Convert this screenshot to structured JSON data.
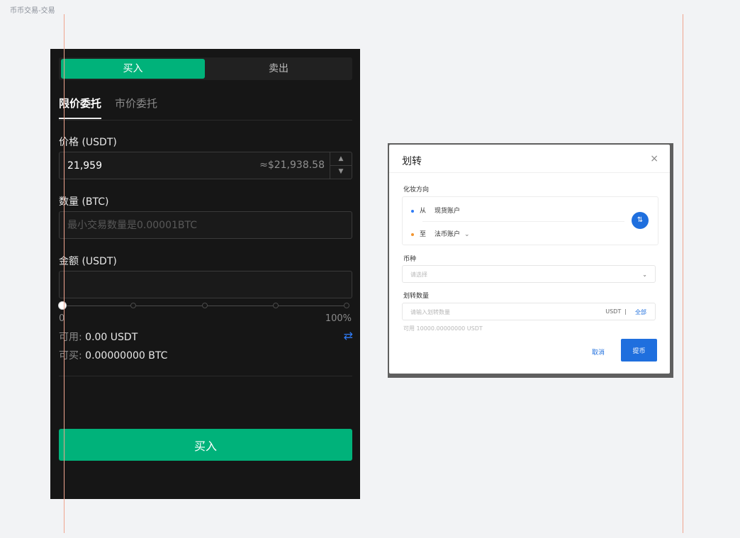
{
  "page": {
    "label": "币币交易-交易"
  },
  "trade": {
    "side_tabs": {
      "buy": "买入",
      "sell": "卖出"
    },
    "order_tabs": {
      "limit": "限价委托",
      "market": "市价委托"
    },
    "price": {
      "label": "价格 (USDT)",
      "value": "21,959",
      "approx": "≈$21,938.58"
    },
    "stepper": {
      "up": "▲",
      "down": "▼"
    },
    "amount": {
      "label": "数量 (BTC)",
      "placeholder": "最小交易数量是0.00001BTC"
    },
    "total": {
      "label": "金额 (USDT)",
      "value": ""
    },
    "slider": {
      "min_label": "0",
      "max_label": "100%",
      "value_fraction": 0
    },
    "available": {
      "key": "可用:",
      "value": " 0.00 USDT"
    },
    "buyable": {
      "key": "可买:",
      "value": " 0.00000000 BTC"
    },
    "swap_icon": "⇄",
    "submit_label": "买入"
  },
  "transfer_modal": {
    "title": "划转",
    "close": "×",
    "direction_label": "化妆方向",
    "from": {
      "prefix": "从",
      "account": "现货账户"
    },
    "to": {
      "prefix": "至",
      "account": "法币账户",
      "chevron": "⌄"
    },
    "swap_glyph": "⇅",
    "currency": {
      "label": "币种",
      "placeholder": "请选择",
      "chevron": "⌄"
    },
    "quantity": {
      "label": "划转数量",
      "placeholder": "请输入划转数量",
      "unit": "USDT",
      "separator": "|",
      "all_label": "全部"
    },
    "available_text": "可用 10000.00000000 USDT",
    "cancel_label": "取消",
    "confirm_label": "提币"
  },
  "colors": {
    "buy_green": "#00b27a",
    "modal_blue": "#1f6fde",
    "panel_bg": "#161616",
    "guide_line": "#f0a58f"
  },
  "icons": {
    "swap": "swap-arrows-icon",
    "close": "close-icon",
    "chevron": "chevron-down-icon"
  }
}
